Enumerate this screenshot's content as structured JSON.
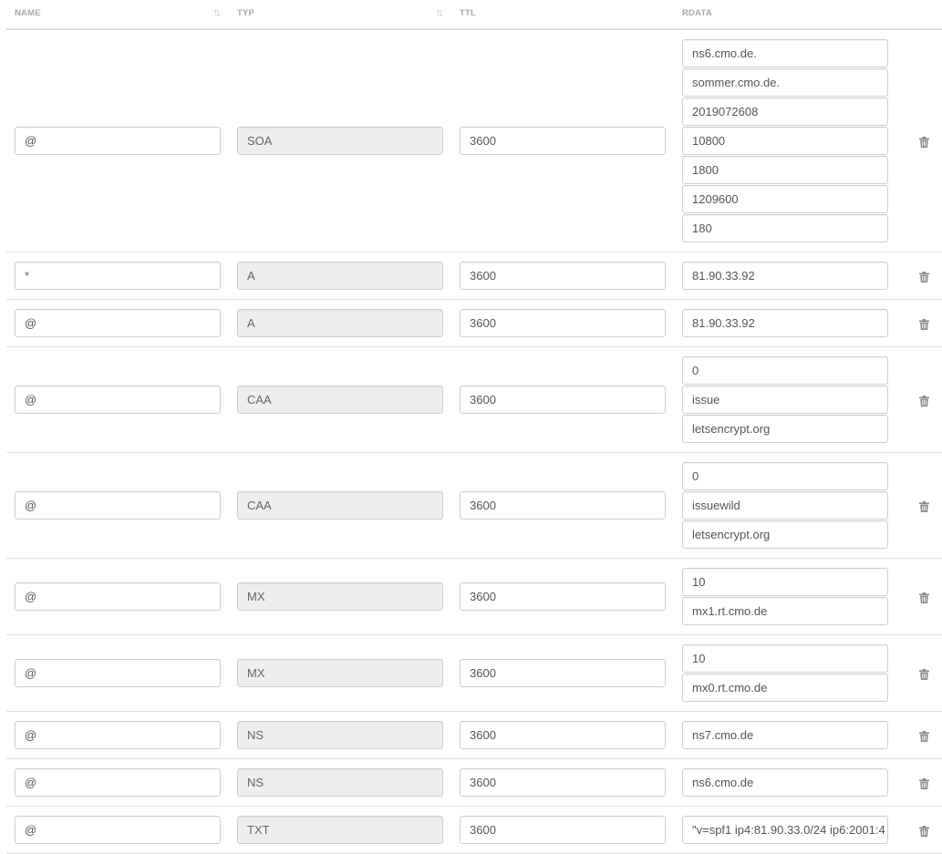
{
  "header": {
    "name": "NAME",
    "type": "TYP",
    "ttl": "TTL",
    "rdata": "RDATA"
  },
  "rows": [
    {
      "name": "@",
      "type": "SOA",
      "ttl": "3600",
      "rdata": [
        "ns6.cmo.de.",
        "sommer.cmo.de.",
        "2019072608",
        "10800",
        "1800",
        "1209600",
        "180"
      ]
    },
    {
      "name": "*",
      "type": "A",
      "ttl": "3600",
      "rdata": [
        "81.90.33.92"
      ]
    },
    {
      "name": "@",
      "type": "A",
      "ttl": "3600",
      "rdata": [
        "81.90.33.92"
      ]
    },
    {
      "name": "@",
      "type": "CAA",
      "ttl": "3600",
      "rdata": [
        "0",
        "issue",
        "letsencrypt.org"
      ]
    },
    {
      "name": "@",
      "type": "CAA",
      "ttl": "3600",
      "rdata": [
        "0",
        "issuewild",
        "letsencrypt.org"
      ]
    },
    {
      "name": "@",
      "type": "MX",
      "ttl": "3600",
      "rdata": [
        "10",
        "mx1.rt.cmo.de"
      ]
    },
    {
      "name": "@",
      "type": "MX",
      "ttl": "3600",
      "rdata": [
        "10",
        "mx0.rt.cmo.de"
      ]
    },
    {
      "name": "@",
      "type": "NS",
      "ttl": "3600",
      "rdata": [
        "ns7.cmo.de"
      ]
    },
    {
      "name": "@",
      "type": "NS",
      "ttl": "3600",
      "rdata": [
        "ns6.cmo.de"
      ]
    },
    {
      "name": "@",
      "type": "TXT",
      "ttl": "3600",
      "rdata": [
        "\"v=spf1 ip4:81.90.33.0/24 ip6:2001:4"
      ]
    }
  ],
  "icons": {
    "sort": "sort-icon",
    "delete": "trash-icon"
  },
  "colors": {
    "readonly_bg": "#eeeeee",
    "border": "#cfcfcf",
    "header_text": "#a8a8a8",
    "icon": "#8a8a8a"
  }
}
